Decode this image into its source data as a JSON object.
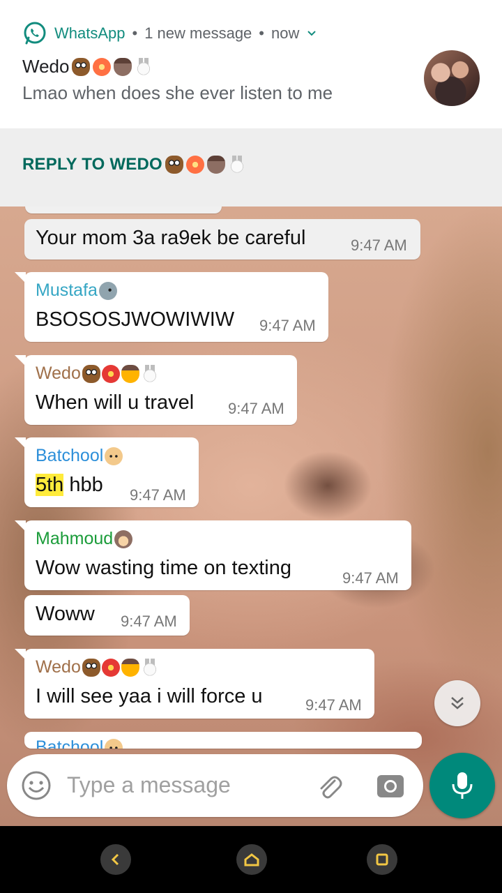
{
  "notification": {
    "app_name": "WhatsApp",
    "separator": "•",
    "summary": "1 new message",
    "time": "now",
    "title": "Wedo",
    "text": "Lmao when does she ever listen to me",
    "reply_label": "REPLY TO WEDO"
  },
  "messages": [
    {
      "text": "Your mom 3a ra9ek be careful",
      "time": "9:47 AM"
    },
    {
      "sender": "Mustafa",
      "sender_color": "#35a6c4",
      "text": "BSOSOSJWOWIWIW",
      "time": "9:47 AM"
    },
    {
      "sender": "Wedo",
      "sender_color": "#a0704a",
      "text": "When will u travel",
      "time": "9:47 AM"
    },
    {
      "sender": "Batchool",
      "sender_color": "#2d8fd9",
      "text_highlight": "5th",
      "text": " hbb",
      "time": "9:47 AM"
    },
    {
      "sender": "Mahmoud",
      "sender_color": "#1b9c3a",
      "text": "Wow wasting time on texting",
      "time": "9:47 AM"
    },
    {
      "text": "Woww",
      "time": "9:47 AM"
    },
    {
      "sender": "Wedo",
      "sender_color": "#a0704a",
      "text": "I will see yaa i will force u",
      "time": "9:47 AM"
    },
    {
      "sender": "Batchool",
      "sender_color": "#2d8fd9"
    }
  ],
  "input": {
    "placeholder": "Type a message"
  },
  "colors": {
    "accent": "#00897B",
    "reply": "#00695C",
    "highlight": "#ffeb3b"
  },
  "icons": [
    "whatsapp-icon",
    "chevron-down-icon",
    "emoji-icon",
    "attach-icon",
    "camera-icon",
    "mic-icon",
    "double-chevron-down-icon",
    "back-icon",
    "home-icon",
    "recents-icon"
  ]
}
